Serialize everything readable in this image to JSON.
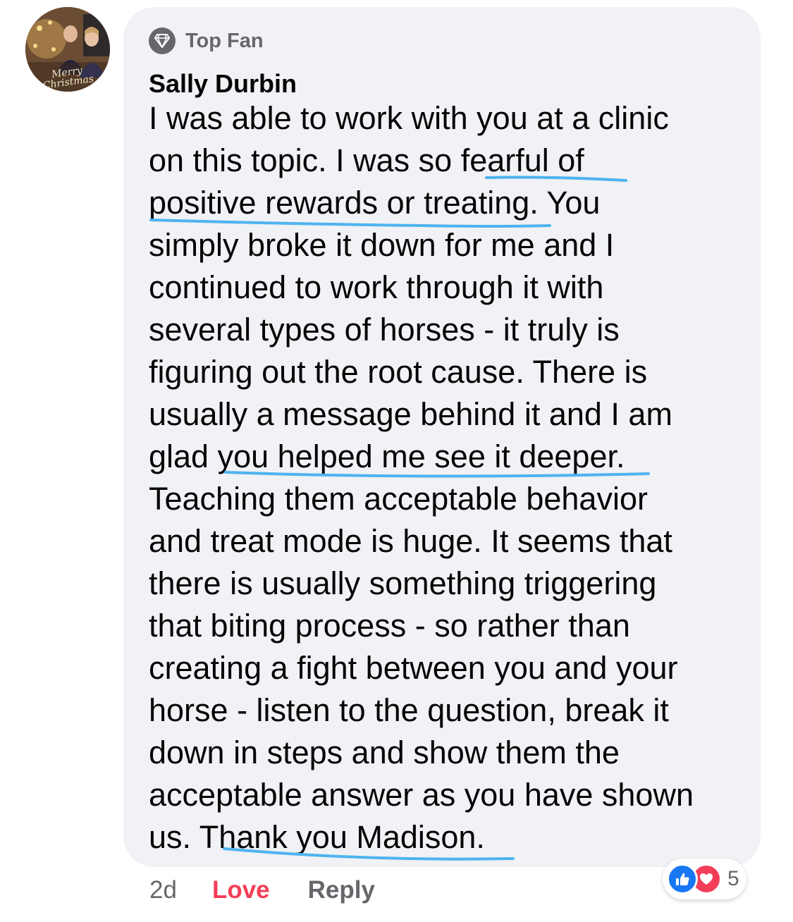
{
  "comment": {
    "avatar_caption": "Merry\nChristmas",
    "badge": {
      "icon": "diamond-icon",
      "label": "Top Fan"
    },
    "author": "Sally Durbin",
    "lines": [
      "I was able to work with you at a clinic",
      "on this topic. I was so fearful of",
      "positive rewards or treating.  You",
      "simply broke it down for me and I",
      "continued to work through it with",
      "several types of horses - it truly is",
      "figuring out the root cause.  There is",
      "usually a message behind it and I am",
      "glad you helped me see it deeper.",
      "Teaching them acceptable behavior",
      "and treat mode is huge.  It seems that",
      "there is usually something triggering",
      "that biting process - so rather than",
      "creating a fight between you and your",
      "horse - listen to the question, break it",
      "down in steps and show them the",
      "acceptable answer as you have shown",
      "us.  Thank you Madison."
    ],
    "annotation_color": "#4fb3f0",
    "bubble_color": "#f0f2f5"
  },
  "actions": {
    "time": "2d",
    "love": "Love",
    "reply": "Reply",
    "love_color": "#f33e58"
  },
  "reactions": {
    "icons": [
      "like-icon",
      "heart-icon"
    ],
    "count": "5"
  }
}
